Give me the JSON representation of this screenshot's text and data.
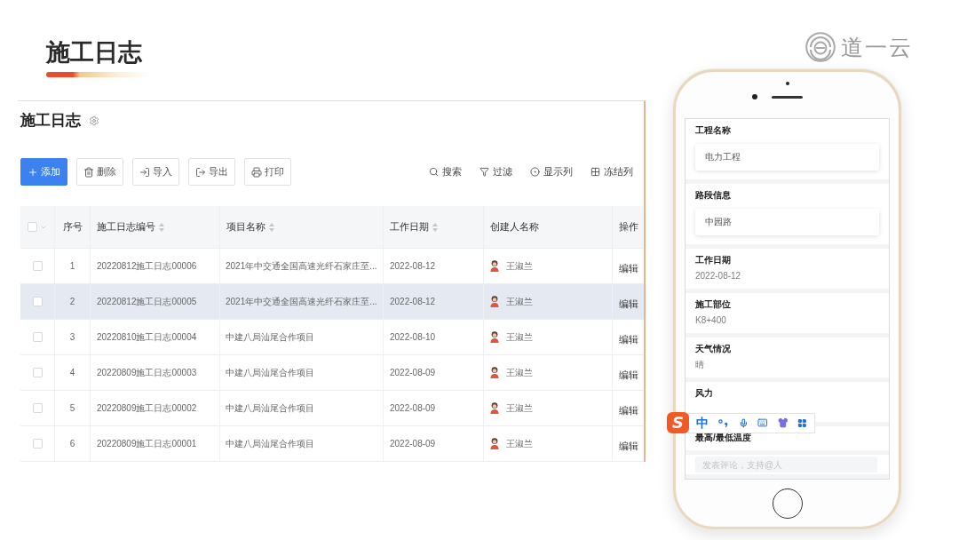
{
  "header": {
    "title": "施工日志"
  },
  "logo": {
    "text": "道一云"
  },
  "panel": {
    "title": "施工日志",
    "actions": [
      {
        "kind": "add",
        "label": "添加",
        "primary": true
      },
      {
        "kind": "delete",
        "label": "删除",
        "primary": false
      },
      {
        "kind": "import",
        "label": "导入",
        "primary": false
      },
      {
        "kind": "export",
        "label": "导出",
        "primary": false
      },
      {
        "kind": "print",
        "label": "打印",
        "primary": false
      }
    ],
    "tools": [
      {
        "kind": "search",
        "label": "搜索"
      },
      {
        "kind": "filter",
        "label": "过滤"
      },
      {
        "kind": "columns",
        "label": "显示列"
      },
      {
        "kind": "freeze",
        "label": "冻结列"
      }
    ]
  },
  "table": {
    "select_all": {
      "checked": false
    },
    "columns": [
      {
        "label": "序号",
        "sortable": false
      },
      {
        "label": "施工日志编号",
        "sortable": true
      },
      {
        "label": "项目名称",
        "sortable": true
      },
      {
        "label": "工作日期",
        "sortable": true
      },
      {
        "label": "创建人名称",
        "sortable": false
      },
      {
        "label": "操作",
        "sortable": false
      }
    ],
    "rows": [
      {
        "checked": false,
        "selected": false,
        "index": "1",
        "code": "20220812施工日志00006",
        "project": "2021年中交通全国高速光纤石家庄至...",
        "date": "2022-08-12",
        "creator": "王淑兰",
        "action": "编辑"
      },
      {
        "checked": false,
        "selected": true,
        "index": "2",
        "code": "20220812施工日志00005",
        "project": "2021年中交通全国高速光纤石家庄至...",
        "date": "2022-08-12",
        "creator": "王淑兰",
        "action": "编辑"
      },
      {
        "checked": false,
        "selected": false,
        "index": "3",
        "code": "20220810施工日志00004",
        "project": "中建八局汕尾合作项目",
        "date": "2022-08-10",
        "creator": "王淑兰",
        "action": "编辑"
      },
      {
        "checked": false,
        "selected": false,
        "index": "4",
        "code": "20220809施工日志00003",
        "project": "中建八局汕尾合作项目",
        "date": "2022-08-09",
        "creator": "王淑兰",
        "action": "编辑"
      },
      {
        "checked": false,
        "selected": false,
        "index": "5",
        "code": "20220809施工日志00002",
        "project": "中建八局汕尾合作项目",
        "date": "2022-08-09",
        "creator": "王淑兰",
        "action": "编辑"
      },
      {
        "checked": false,
        "selected": false,
        "index": "6",
        "code": "20220809施工日志00001",
        "project": "中建八局汕尾合作项目",
        "date": "2022-08-09",
        "creator": "王淑兰",
        "action": "编辑"
      }
    ]
  },
  "phone": {
    "fields": [
      {
        "kind": "input",
        "label": "工程名称",
        "value": "电力工程"
      },
      {
        "kind": "input",
        "label": "路段信息",
        "value": "中园路"
      },
      {
        "kind": "text",
        "label": "工作日期",
        "value": "2022-08-12"
      },
      {
        "kind": "text",
        "label": "施工部位",
        "value": "K8+400"
      },
      {
        "kind": "text",
        "label": "天气情况",
        "value": "晴"
      },
      {
        "kind": "text",
        "label": "风力"
      },
      {
        "kind": "heading",
        "label": "最高/最低温度"
      }
    ],
    "comment": {
      "placeholder": "发表评论，支持@人"
    },
    "ime_toolbar": {
      "logo": "S",
      "mode": "中"
    }
  }
}
